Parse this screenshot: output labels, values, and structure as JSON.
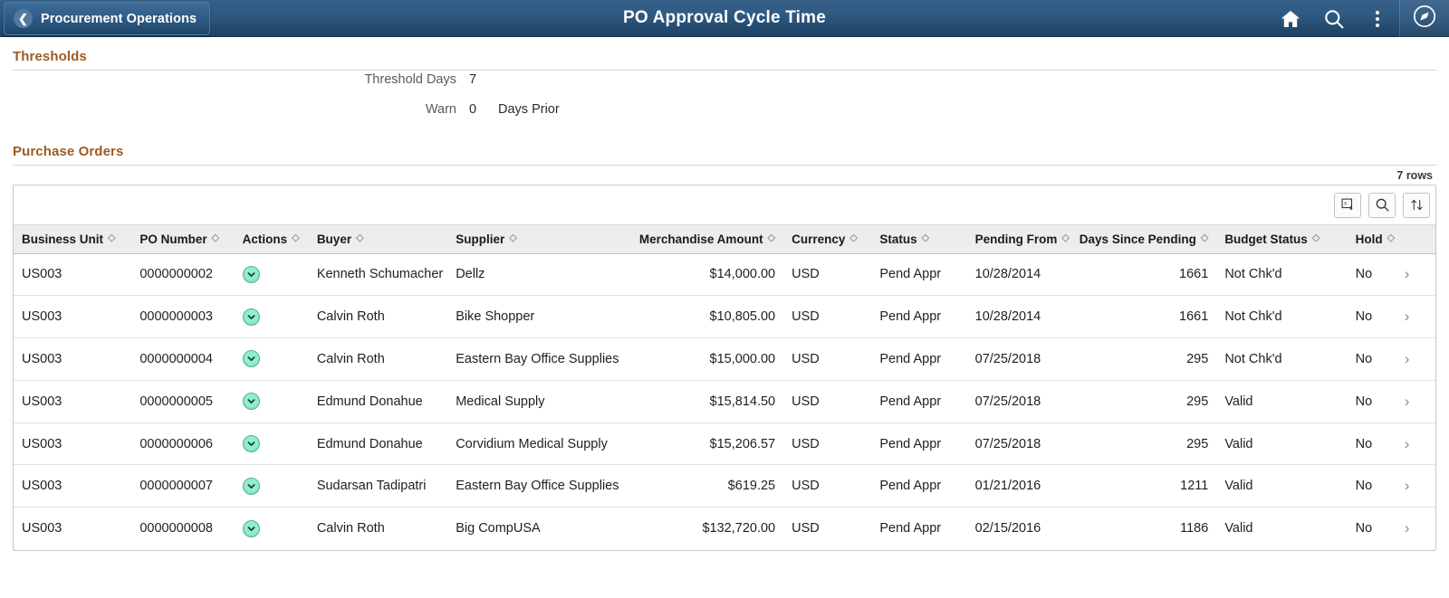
{
  "header": {
    "back_label": "Procurement Operations",
    "title": "PO Approval Cycle Time",
    "back_icon": "chevron-left-icon",
    "icons": [
      "home-icon",
      "search-icon",
      "actions-menu-icon",
      "navbar-compass-icon"
    ],
    "bar_color": "#2f5a82"
  },
  "thresholds": {
    "section_title": "Thresholds",
    "threshold_days_label": "Threshold Days",
    "threshold_days_value": "7",
    "warn_label": "Warn",
    "warn_value": "0",
    "warn_suffix": "Days Prior"
  },
  "purchase_orders": {
    "section_title": "Purchase Orders",
    "rows_count": "7 rows",
    "toolbar": {
      "export_icon": "download-to-excel-icon",
      "find_icon": "search-icon",
      "sort_icon": "sort-updown-icon"
    },
    "columns": [
      {
        "key": "business_unit",
        "label": "Business Unit",
        "align": "left"
      },
      {
        "key": "po_number",
        "label": "PO Number",
        "align": "left"
      },
      {
        "key": "actions",
        "label": "Actions",
        "align": "left"
      },
      {
        "key": "buyer",
        "label": "Buyer",
        "align": "left"
      },
      {
        "key": "supplier",
        "label": "Supplier",
        "align": "left"
      },
      {
        "key": "merchandise_amount",
        "label": "Merchandise Amount",
        "align": "right"
      },
      {
        "key": "currency",
        "label": "Currency",
        "align": "left"
      },
      {
        "key": "status",
        "label": "Status",
        "align": "left"
      },
      {
        "key": "pending_from",
        "label": "Pending From",
        "align": "left"
      },
      {
        "key": "days_since_pending",
        "label": "Days Since Pending",
        "align": "right"
      },
      {
        "key": "budget_status",
        "label": "Budget Status",
        "align": "left"
      },
      {
        "key": "hold",
        "label": "Hold",
        "align": "left"
      }
    ],
    "rows": [
      {
        "business_unit": "US003",
        "po_number": "0000000002",
        "actions_icon": "action-chevron-down-icon",
        "buyer": "Kenneth Schumacher",
        "supplier": "Dellz",
        "merchandise_amount": "$14,000.00",
        "currency": "USD",
        "status": "Pend Appr",
        "pending_from": "10/28/2014",
        "days_since_pending": "1661",
        "budget_status": "Not Chk'd",
        "hold": "No",
        "row_arrow": "chevron-right-icon"
      },
      {
        "business_unit": "US003",
        "po_number": "0000000003",
        "actions_icon": "action-chevron-down-icon",
        "buyer": "Calvin Roth",
        "supplier": "Bike Shopper",
        "merchandise_amount": "$10,805.00",
        "currency": "USD",
        "status": "Pend Appr",
        "pending_from": "10/28/2014",
        "days_since_pending": "1661",
        "budget_status": "Not Chk'd",
        "hold": "No",
        "row_arrow": "chevron-right-icon"
      },
      {
        "business_unit": "US003",
        "po_number": "0000000004",
        "actions_icon": "action-chevron-down-icon",
        "buyer": "Calvin Roth",
        "supplier": "Eastern Bay Office Supplies",
        "merchandise_amount": "$15,000.00",
        "currency": "USD",
        "status": "Pend Appr",
        "pending_from": "07/25/2018",
        "days_since_pending": "295",
        "budget_status": "Not Chk'd",
        "hold": "No",
        "row_arrow": "chevron-right-icon"
      },
      {
        "business_unit": "US003",
        "po_number": "0000000005",
        "actions_icon": "action-chevron-down-icon",
        "buyer": "Edmund Donahue",
        "supplier": "Medical Supply",
        "merchandise_amount": "$15,814.50",
        "currency": "USD",
        "status": "Pend Appr",
        "pending_from": "07/25/2018",
        "days_since_pending": "295",
        "budget_status": "Valid",
        "hold": "No",
        "row_arrow": "chevron-right-icon"
      },
      {
        "business_unit": "US003",
        "po_number": "0000000006",
        "actions_icon": "action-chevron-down-icon",
        "buyer": "Edmund Donahue",
        "supplier": "Corvidium Medical Supply",
        "merchandise_amount": "$15,206.57",
        "currency": "USD",
        "status": "Pend Appr",
        "pending_from": "07/25/2018",
        "days_since_pending": "295",
        "budget_status": "Valid",
        "hold": "No",
        "row_arrow": "chevron-right-icon"
      },
      {
        "business_unit": "US003",
        "po_number": "0000000007",
        "actions_icon": "action-chevron-down-icon",
        "buyer": "Sudarsan Tadipatri",
        "supplier": "Eastern Bay Office Supplies",
        "merchandise_amount": "$619.25",
        "currency": "USD",
        "status": "Pend Appr",
        "pending_from": "01/21/2016",
        "days_since_pending": "1211",
        "budget_status": "Valid",
        "hold": "No",
        "row_arrow": "chevron-right-icon"
      },
      {
        "business_unit": "US003",
        "po_number": "0000000008",
        "actions_icon": "action-chevron-down-icon",
        "buyer": "Calvin Roth",
        "supplier": "Big CompUSA",
        "merchandise_amount": "$132,720.00",
        "currency": "USD",
        "status": "Pend Appr",
        "pending_from": "02/15/2016",
        "days_since_pending": "1186",
        "budget_status": "Valid",
        "hold": "No",
        "row_arrow": "chevron-right-icon"
      }
    ]
  }
}
